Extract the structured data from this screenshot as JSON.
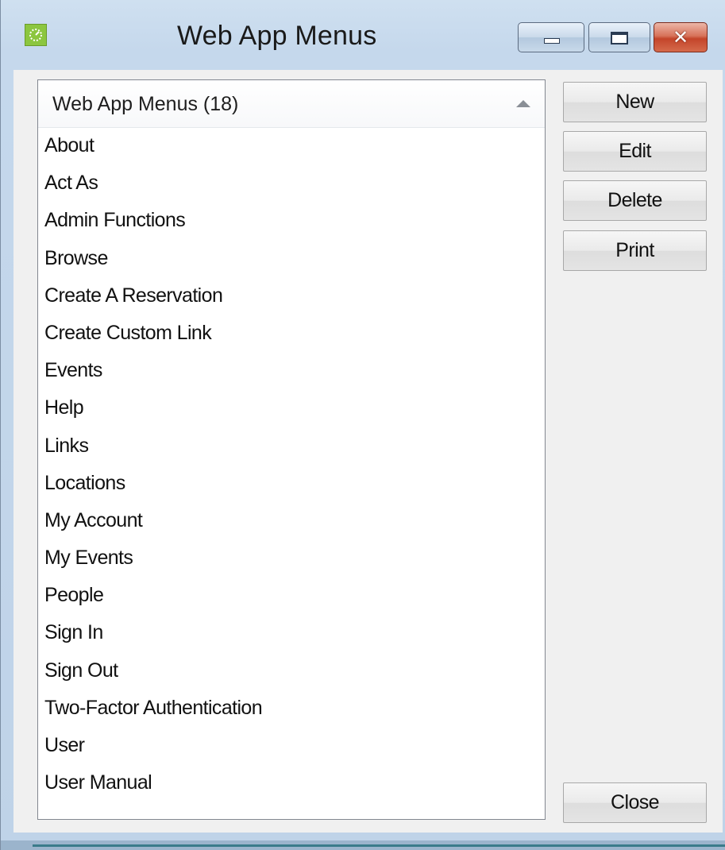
{
  "window": {
    "title": "Web App Menus",
    "icon": "app-logo-icon",
    "controls": {
      "minimize_icon": "minimize-icon",
      "maximize_icon": "maximize-icon",
      "close_icon": "close-icon",
      "close_glyph": "✕"
    },
    "close_button_color": "#c4452a"
  },
  "list": {
    "header": "Web App Menus (18)",
    "sort_icon": "sort-ascending-icon",
    "items": [
      "About",
      "Act As",
      "Admin Functions",
      "Browse",
      "Create A Reservation",
      "Create Custom Link",
      "Events",
      "Help",
      "Links",
      "Locations",
      "My Account",
      "My Events",
      "People",
      "Sign In",
      "Sign Out",
      "Two-Factor Authentication",
      "User",
      "User Manual"
    ]
  },
  "buttons": {
    "new": "New",
    "edit": "Edit",
    "delete": "Delete",
    "print": "Print",
    "close": "Close"
  }
}
